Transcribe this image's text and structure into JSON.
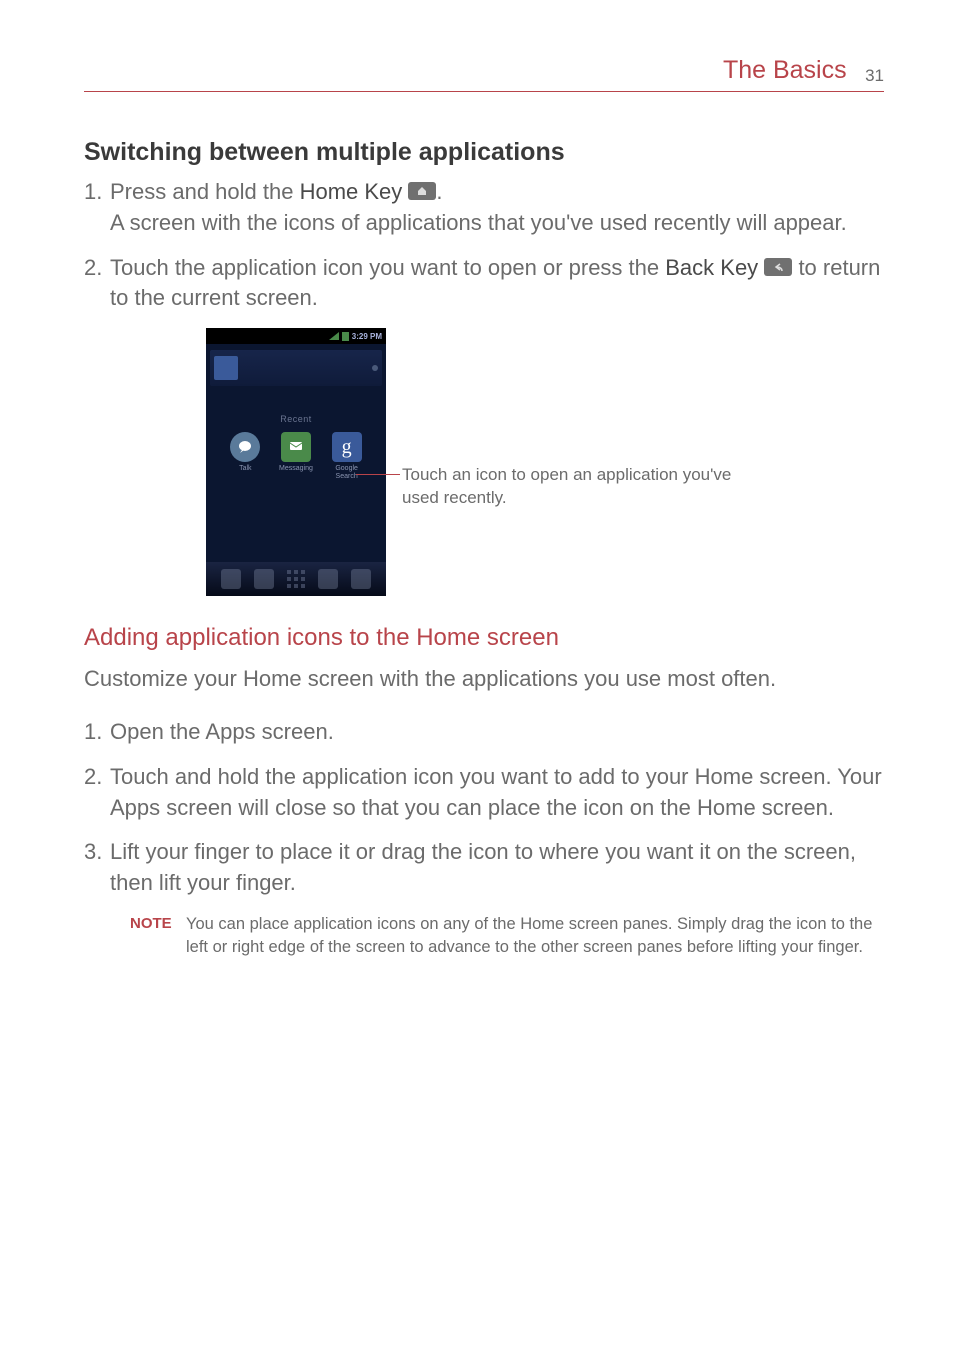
{
  "header": {
    "title": "The Basics",
    "page_number": "31"
  },
  "section1": {
    "heading": "Switching between multiple applications",
    "step1_a": "Press and hold the ",
    "step1_key": "Home Key",
    "step1_b": ".",
    "step1_desc": "A screen with the icons of applications that you've used recently will appear.",
    "step2_a": "Touch the application icon you want to open or press the ",
    "step2_key": "Back Key",
    "step2_b": " to return to the current screen."
  },
  "screenshot": {
    "time": "3:29 PM",
    "recent_label": "Recent",
    "apps": {
      "talk": "Talk",
      "messaging": "Messaging",
      "google": "Google Search",
      "g_char": "g"
    },
    "callout": "Touch an icon to open an application you've used recently."
  },
  "section2": {
    "heading": "Adding application icons to the Home screen",
    "intro": "Customize your Home screen with the applications you use most often.",
    "step1": "Open the Apps screen.",
    "step2": "Touch and hold the application icon you want to add to your Home screen. Your Apps screen will close so that you can place the icon on the Home screen.",
    "step3": "Lift your finger to place it or drag the icon to where you want it on the screen, then lift your finger.",
    "note_label": "NOTE",
    "note_text": "You can place application icons on any of the Home screen panes.  Simply drag the icon to the left or right edge of the screen to advance to the other screen panes before lifting your finger."
  }
}
